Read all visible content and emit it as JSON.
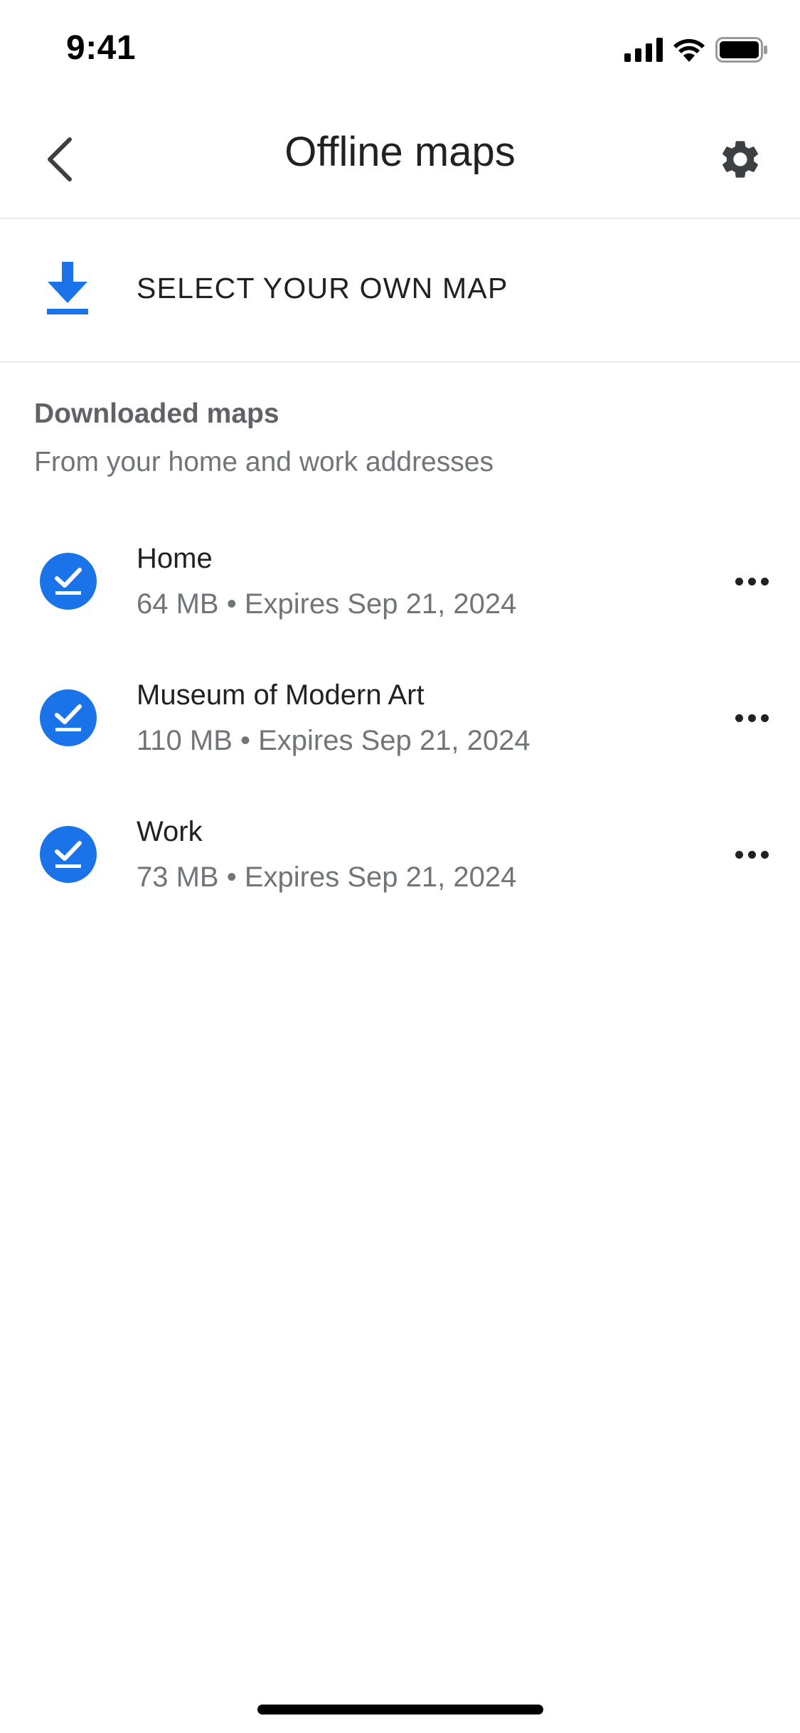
{
  "status_bar": {
    "time": "9:41",
    "icons": [
      "signal-icon",
      "wifi-icon",
      "battery-icon"
    ]
  },
  "header": {
    "back_icon": "chevron-left-icon",
    "title": "Offline maps",
    "settings_icon": "gear-icon"
  },
  "select_map": {
    "icon": "download-icon",
    "label": "SELECT YOUR OWN MAP"
  },
  "section": {
    "title": "Downloaded maps",
    "subtitle": "From your home and work addresses"
  },
  "maps": [
    {
      "name": "Home",
      "meta": "64 MB • Expires Sep 21, 2024",
      "icon": "downloaded-check-icon",
      "menu_icon": "more-horizontal-icon"
    },
    {
      "name": "Museum of Modern Art",
      "meta": "110 MB • Expires Sep 21, 2024",
      "icon": "downloaded-check-icon",
      "menu_icon": "more-horizontal-icon"
    },
    {
      "name": "Work",
      "meta": "73 MB • Expires Sep 21, 2024",
      "icon": "downloaded-check-icon",
      "menu_icon": "more-horizontal-icon"
    }
  ],
  "colors": {
    "accent": "#1a73e8",
    "text_primary": "#202124",
    "text_secondary": "#70757a",
    "divider": "#e8eaed"
  }
}
